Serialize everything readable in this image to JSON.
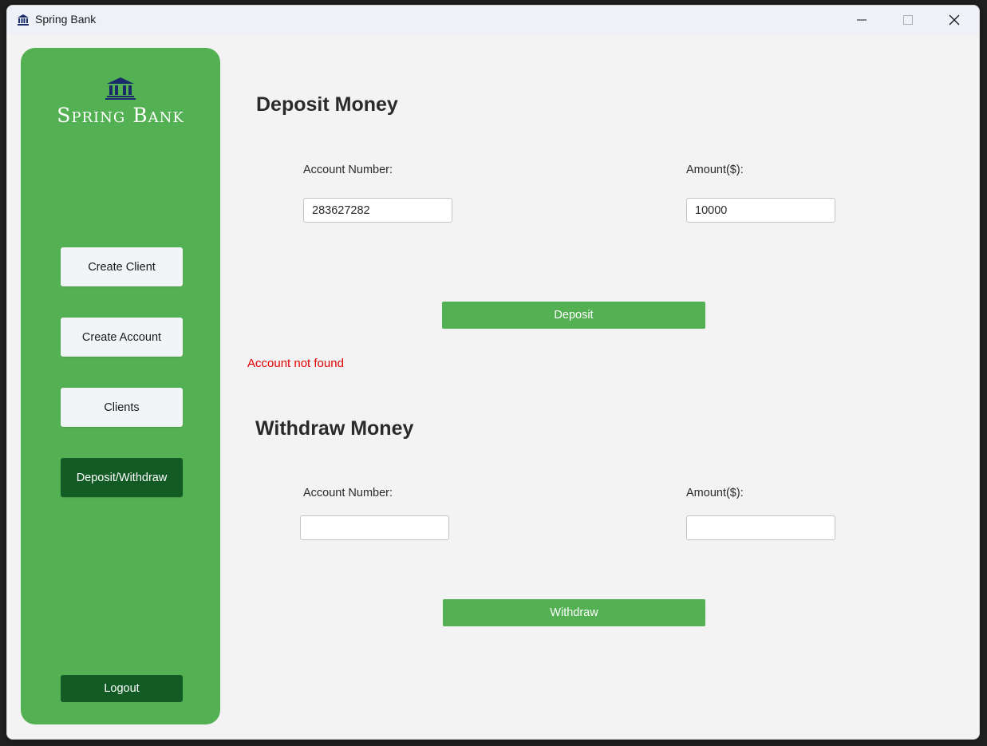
{
  "window": {
    "title": "Spring Bank"
  },
  "sidebar": {
    "logo_text": "Spring Bank",
    "nav": [
      {
        "label": "Create Client"
      },
      {
        "label": "Create Account"
      },
      {
        "label": "Clients"
      },
      {
        "label": "Deposit/Withdraw",
        "active": true
      }
    ],
    "logout_label": "Logout"
  },
  "deposit": {
    "title": "Deposit Money",
    "account_label": "Account Number:",
    "account_value": "283627282",
    "amount_label": "Amount($):",
    "amount_value": "10000",
    "button_label": "Deposit",
    "status_message": "Account not found"
  },
  "withdraw": {
    "title": "Withdraw Money",
    "account_label": "Account Number:",
    "account_value": "",
    "amount_label": "Amount($):",
    "amount_value": "",
    "button_label": "Withdraw"
  },
  "colors": {
    "sidebar": "#53b053",
    "active_nav": "#125b24",
    "error": "#e00000",
    "logo_icon": "#1a2b6b"
  },
  "icons": {
    "app": "bank-icon",
    "logo": "bank-building-icon",
    "minimize": "minimize-icon",
    "maximize": "maximize-icon",
    "close": "close-icon"
  }
}
